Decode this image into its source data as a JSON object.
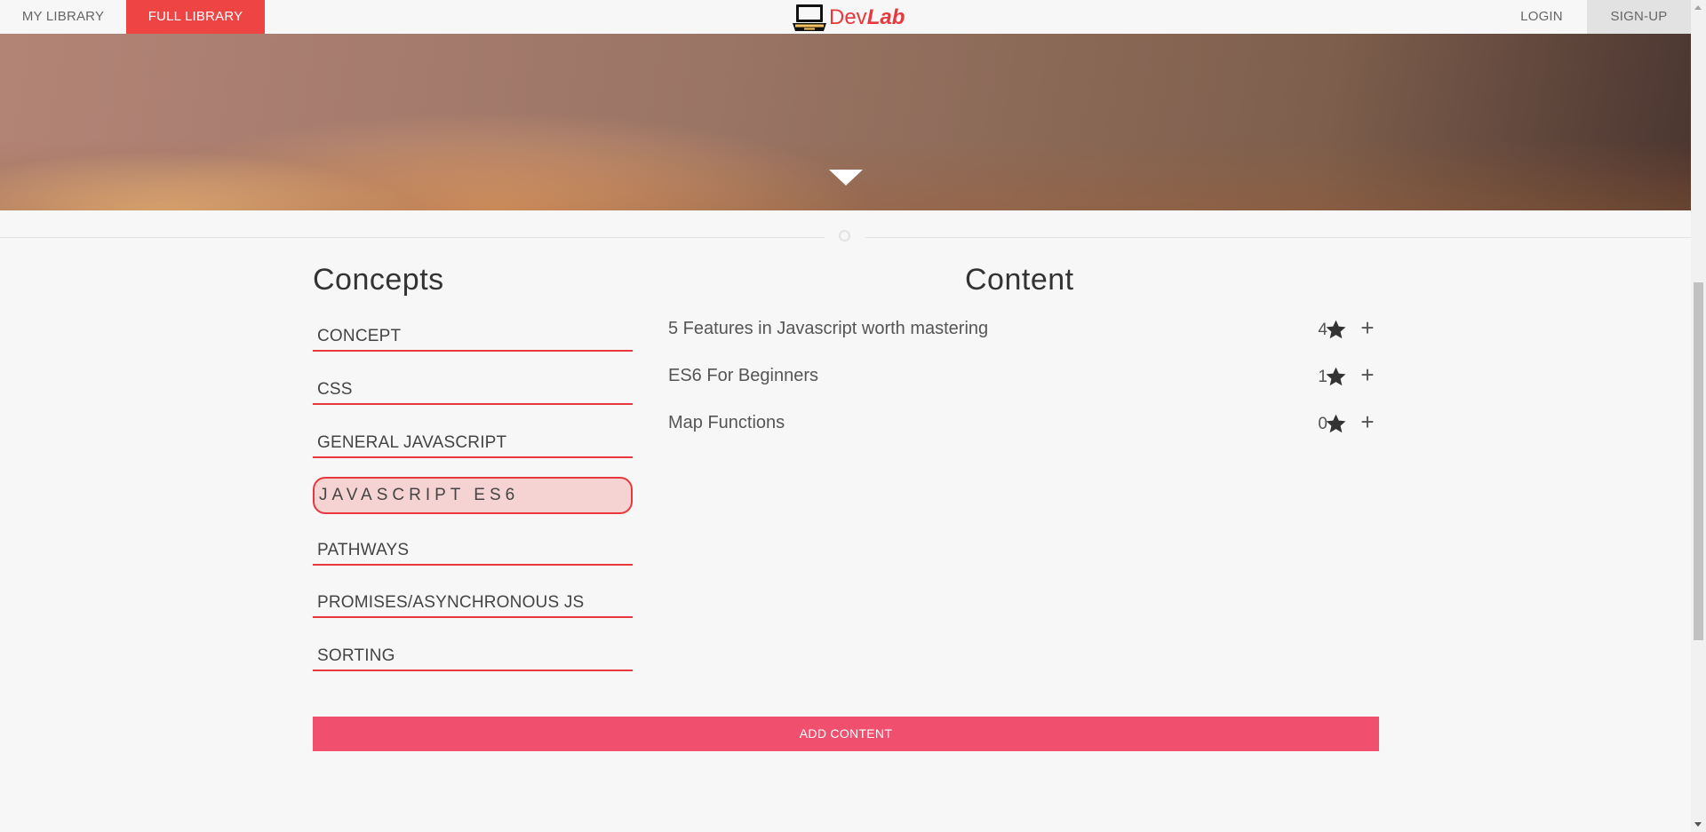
{
  "nav": {
    "my_library": "MY LIBRARY",
    "full_library": "FULL LIBRARY",
    "login": "LOGIN",
    "signup": "SIGN-UP"
  },
  "logo": {
    "part1": "Dev",
    "part2": "Lab",
    "icon": "laptop-icon"
  },
  "concepts": {
    "title": "Concepts",
    "items": [
      {
        "label": "CONCEPT"
      },
      {
        "label": "CSS"
      },
      {
        "label": "GENERAL JAVASCRIPT"
      },
      {
        "label": "JAVASCRIPT ES6",
        "selected": true
      },
      {
        "label": "PATHWAYS"
      },
      {
        "label": "PROMISES/ASYNCHRONOUS JS"
      },
      {
        "label": "SORTING"
      }
    ]
  },
  "content": {
    "title": "Content",
    "items": [
      {
        "label": "5 Features in Javascript worth mastering",
        "stars": "4"
      },
      {
        "label": "ES6 For Beginners",
        "stars": "1"
      },
      {
        "label": "Map Functions",
        "stars": "0"
      }
    ]
  },
  "add_content_label": "ADD CONTENT",
  "colors": {
    "accent": "#ee4444",
    "add_button": "#f0506e",
    "selected_bg": "#f5d3d3"
  }
}
